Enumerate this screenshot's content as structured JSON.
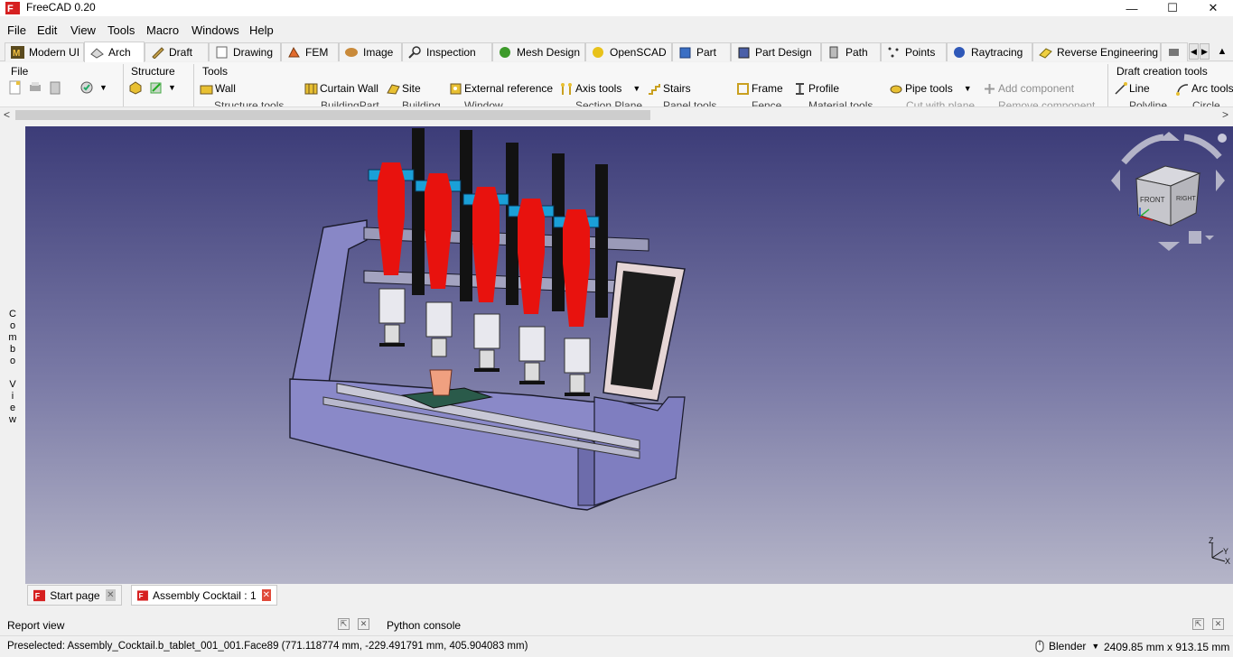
{
  "window": {
    "title": "FreeCAD 0.20",
    "min_glyph": "—",
    "max_glyph": "☐",
    "close_glyph": "✕"
  },
  "menu": [
    "File",
    "Edit",
    "View",
    "Tools",
    "Macro",
    "Windows",
    "Help"
  ],
  "workbench_tabs": [
    {
      "label": "Modern UI",
      "icon": "modern-ui-icon"
    },
    {
      "label": "Arch",
      "icon": "arch-icon",
      "active": true
    },
    {
      "label": "Draft",
      "icon": "draft-icon"
    },
    {
      "label": "Drawing",
      "icon": "drawing-icon"
    },
    {
      "label": "FEM",
      "icon": "fem-icon"
    },
    {
      "label": "Image",
      "icon": "image-icon"
    },
    {
      "label": "Inspection",
      "icon": "inspection-icon"
    },
    {
      "label": "Mesh Design",
      "icon": "mesh-design-icon"
    },
    {
      "label": "OpenSCAD",
      "icon": "openscad-icon"
    },
    {
      "label": "Part",
      "icon": "part-icon"
    },
    {
      "label": "Part Design",
      "icon": "part-design-icon"
    },
    {
      "label": "Path",
      "icon": "path-icon"
    },
    {
      "label": "Points",
      "icon": "points-icon"
    },
    {
      "label": "Raytracing",
      "icon": "raytracing-icon"
    },
    {
      "label": "Reverse Engineering",
      "icon": "reverse-engineering-icon"
    }
  ],
  "ribbon": {
    "groups": {
      "file": "File",
      "structure": "Structure",
      "tools": "Tools",
      "draft": "Draft creation tools"
    },
    "tools": {
      "wall": "Wall",
      "curtain_wall": "Curtain Wall",
      "site": "Site",
      "external_reference": "External reference",
      "axis_tools": "Axis tools",
      "stairs": "Stairs",
      "frame": "Frame",
      "profile": "Profile",
      "pipe_tools": "Pipe tools",
      "add_component": "Add component",
      "line": "Line",
      "arc_tools": "Arc tools"
    },
    "row2": {
      "structure_tools": "Structure tools",
      "building_part": "BuildingPart",
      "building": "Building",
      "window": "Window",
      "section_plane": "Section Plane",
      "panel_tools": "Panel tools",
      "fence": "Fence",
      "material_tools": "Material tools",
      "cut_with_plane": "Cut with plane",
      "remove_component": "Remove component",
      "polyline": "Polyline",
      "circle": "Circle"
    }
  },
  "combo_view": {
    "label": "Combo View"
  },
  "nav_cube": {
    "front": "FRONT",
    "right": "RIGHT"
  },
  "axis_labels": {
    "z": "Z",
    "y": "Y",
    "x": "X"
  },
  "document_tabs": [
    {
      "label": "Start page",
      "active": false
    },
    {
      "label": "Assembly Cocktail : 1",
      "active": true
    }
  ],
  "panels": {
    "report": "Report view",
    "python": "Python console"
  },
  "status": {
    "preselected": "Preselected: Assembly_Cocktail.b_tablet_001_001.Face89 (771.118774 mm, -229.491791 mm, 405.904083 mm)",
    "navigation_style": "Blender",
    "dimensions": "2409.85 mm x 913.15 mm"
  },
  "colors": {
    "viewport_top": "#3c3c78",
    "viewport_bottom": "#b5b5c8",
    "bottle_red": "#e8120e",
    "frame_lavender": "#8a89c8",
    "collar_blue": "#1aa0d8",
    "close_red": "#e04a3a"
  }
}
